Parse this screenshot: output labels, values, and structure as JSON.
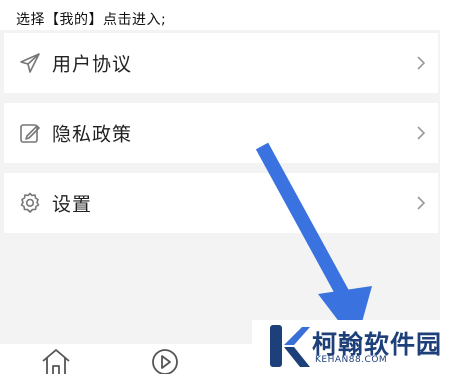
{
  "instruction_text": "选择【我的】点击进入;",
  "menu": {
    "items": [
      {
        "label": "用户协议",
        "icon": "paper-plane-icon"
      },
      {
        "label": "隐私政策",
        "icon": "edit-icon"
      },
      {
        "label": "设置",
        "icon": "gear-icon"
      }
    ]
  },
  "bottom_nav": {
    "items": [
      {
        "icon": "home-icon"
      },
      {
        "icon": "play-icon"
      }
    ]
  },
  "watermark": {
    "name": "柯翰软件园",
    "url": "KEHAN88.COM"
  },
  "colors": {
    "arrow": "#3a73e0",
    "logo": "#1d3f7a",
    "divider_bg": "#f3f3f3"
  }
}
